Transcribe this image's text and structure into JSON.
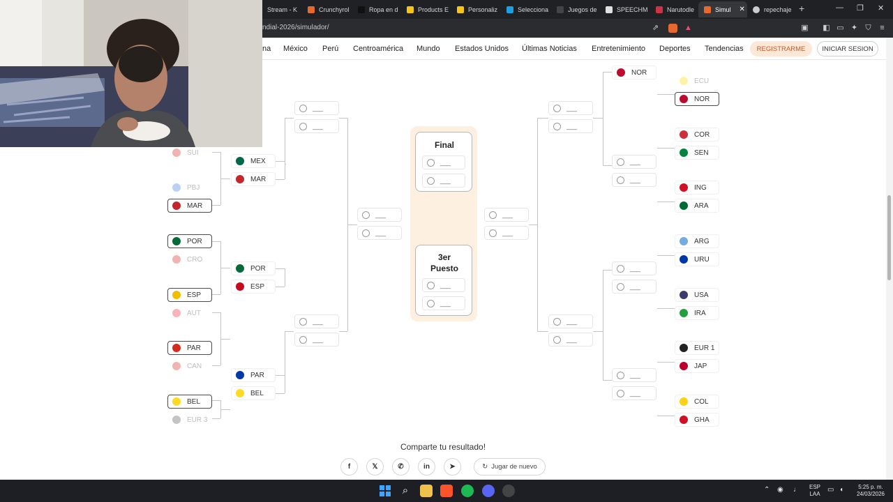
{
  "tabs": [
    {
      "label": "Stream - K"
    },
    {
      "label": "Crunchyrol"
    },
    {
      "label": "Ropa en d"
    },
    {
      "label": "Products E"
    },
    {
      "label": "Personaliz"
    },
    {
      "label": "Selecciona"
    },
    {
      "label": "Juegos de"
    },
    {
      "label": "SPEECHM"
    },
    {
      "label": "Narutodle"
    },
    {
      "label": "Simul"
    },
    {
      "label": "repechaje"
    }
  ],
  "tab_colors": [
    "#3a3a3a",
    "#e8692e",
    "#222222",
    "#f5c518",
    "#f5c518",
    "#1ba1e2",
    "#2a2a2a",
    "#f0f0f0",
    "#cc3344",
    "#e8692e",
    "#cccccc"
  ],
  "address": {
    "url": "ndial-2026/simulador/"
  },
  "nav": {
    "links": [
      "na",
      "México",
      "Perú",
      "Centroamérica",
      "Mundo",
      "Estados Unidos",
      "Últimas Noticias",
      "Entretenimiento",
      "Deportes",
      "Tendencias"
    ],
    "register": "REGISTRARME",
    "login": "INICIAR SESION"
  },
  "bracket": {
    "left_r32": [
      {
        "code": "SUI",
        "selected": false,
        "flag": "#d52b1e"
      },
      {
        "code": "PBJ",
        "selected": false,
        "flag": "#3d7be0"
      },
      {
        "code": "MAR",
        "selected": true,
        "flag": "#c1272d"
      },
      {
        "code": "POR",
        "selected": true,
        "flag": "#046a38"
      },
      {
        "code": "CRO",
        "selected": false,
        "flag": "#d52b1e"
      },
      {
        "code": "ESP",
        "selected": true,
        "flag": "#f1bf00"
      },
      {
        "code": "AUT",
        "selected": false,
        "flag": "#ed2939"
      },
      {
        "code": "PAR",
        "selected": true,
        "flag": "#d52b1e"
      },
      {
        "code": "CAN",
        "selected": false,
        "flag": "#d52b1e"
      },
      {
        "code": "BEL",
        "selected": true,
        "flag": "#fdda24"
      },
      {
        "code": "EUR 3",
        "selected": false,
        "flag": "#555555"
      }
    ],
    "left_r16": [
      {
        "code": "MEX",
        "flag": "#006847"
      },
      {
        "code": "MAR",
        "flag": "#c1272d"
      },
      {
        "code": "POR",
        "flag": "#046a38"
      },
      {
        "code": "ESP",
        "flag": "#c60b1e"
      },
      {
        "code": "PAR",
        "flag": "#0038a8"
      },
      {
        "code": "BEL",
        "flag": "#fdda24"
      }
    ],
    "right_r32": [
      {
        "code": "ECU",
        "selected": false,
        "flag": "#ffdd00"
      },
      {
        "code": "NOR",
        "selected": true,
        "flag": "#ba0c2f"
      },
      {
        "code": "COR",
        "selected": false,
        "flag": "#cd2e3a"
      },
      {
        "code": "SEN",
        "selected": false,
        "flag": "#00853f"
      },
      {
        "code": "ING",
        "selected": false,
        "flag": "#ce1124"
      },
      {
        "code": "ARA",
        "selected": false,
        "flag": "#006c35"
      },
      {
        "code": "ARG",
        "selected": false,
        "flag": "#74acdf"
      },
      {
        "code": "URU",
        "selected": false,
        "flag": "#0038a8"
      },
      {
        "code": "USA",
        "selected": false,
        "flag": "#3c3b6e"
      },
      {
        "code": "IRA",
        "selected": false,
        "flag": "#239f40"
      },
      {
        "code": "EUR 1",
        "selected": false,
        "flag": "#222222"
      },
      {
        "code": "JAP",
        "selected": false,
        "flag": "#bc002d"
      },
      {
        "code": "COL",
        "selected": false,
        "flag": "#fcd116"
      },
      {
        "code": "GHA",
        "selected": false,
        "flag": "#ce1126"
      }
    ],
    "right_r16_top": {
      "code": "NOR",
      "flag": "#ba0c2f"
    },
    "empty_label": "___",
    "final_title": "Final",
    "third_title_1": "3er",
    "third_title_2": "Puesto"
  },
  "share": {
    "title": "Comparte tu resultado!",
    "buttons": [
      "f",
      "𝕏",
      "✆",
      "in",
      "➤"
    ],
    "replay": "Jugar de nuevo",
    "replay_icon": "↻"
  },
  "taskbar": {
    "lang_1": "ESP",
    "lang_2": "LAA",
    "time": "5:25 p. m.",
    "date": "24/03/2026"
  }
}
